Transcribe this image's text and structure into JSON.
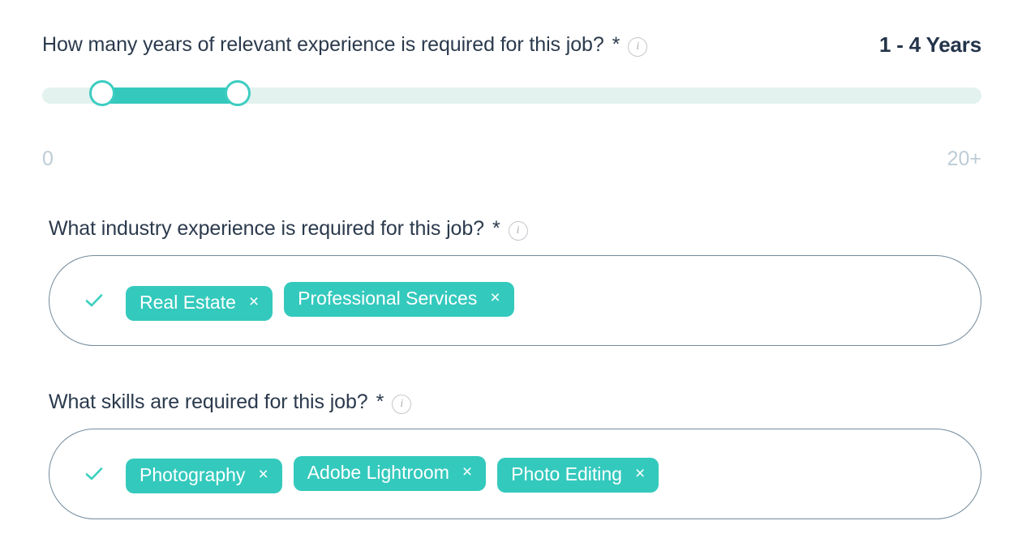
{
  "colors": {
    "accent_teal": "#34c9bd",
    "track_bg": "#e3f2ef",
    "text_dark": "#2b3a4d",
    "scale_text": "#bdccd6",
    "field_border": "#738b9b",
    "info_icon": "#a9aeb3"
  },
  "experience": {
    "question": "How many years of relevant experience is required for this job?",
    "required_mark": "*",
    "info_icon": "info-circle-icon",
    "value_label": "1 - 4 Years",
    "slider": {
      "min_label": "0",
      "max_label": "20+",
      "min_value": 0,
      "max_value": 20,
      "selected_min": 1,
      "selected_max": 4,
      "lower_thumb_percent": 6.4,
      "upper_thumb_percent": 20.8
    }
  },
  "industry": {
    "question": "What industry experience is required for this job?",
    "required_mark": "*",
    "info_icon": "info-circle-icon",
    "check_icon": "check-icon",
    "tags": [
      {
        "label": "Real Estate",
        "remove_icon": "close-icon",
        "remove_label": "×"
      },
      {
        "label": "Professional Services",
        "remove_icon": "close-icon",
        "remove_label": "×"
      }
    ]
  },
  "skills": {
    "question": "What skills are required for this job?",
    "required_mark": "*",
    "info_icon": "info-circle-icon",
    "check_icon": "check-icon",
    "tags": [
      {
        "label": "Photography",
        "remove_icon": "close-icon",
        "remove_label": "×"
      },
      {
        "label": "Adobe Lightroom",
        "remove_icon": "close-icon",
        "remove_label": "×"
      },
      {
        "label": "Photo Editing",
        "remove_icon": "close-icon",
        "remove_label": "×"
      }
    ]
  },
  "icon_glyphs": {
    "info": "i"
  }
}
